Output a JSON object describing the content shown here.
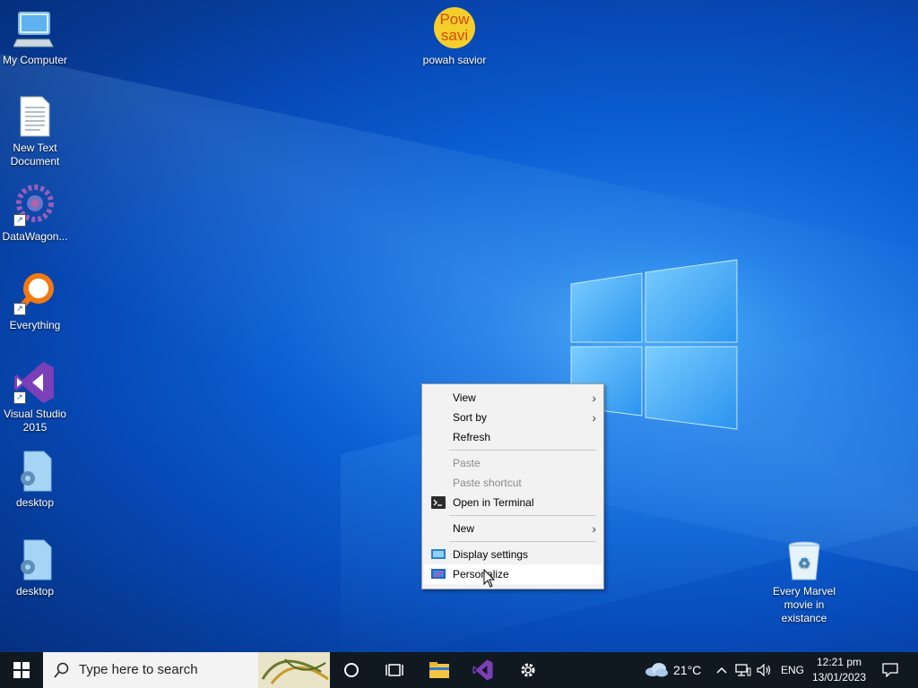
{
  "desktop": {
    "icons": [
      {
        "label": "My Computer"
      },
      {
        "label": "New Text Document"
      },
      {
        "label": "DataWagon..."
      },
      {
        "label": "Everything"
      },
      {
        "label": "Visual Studio 2015"
      },
      {
        "label": "desktop"
      },
      {
        "label": "desktop"
      },
      {
        "label": "powah savior"
      },
      {
        "label": "Every Marvel movie in existance"
      }
    ],
    "powah_badge_text": "Pow savi"
  },
  "context_menu": {
    "items": [
      {
        "label": "View",
        "has_submenu": true,
        "disabled": false
      },
      {
        "label": "Sort by",
        "has_submenu": true,
        "disabled": false
      },
      {
        "label": "Refresh",
        "has_submenu": false,
        "disabled": false
      },
      {
        "label": "Paste",
        "has_submenu": false,
        "disabled": true
      },
      {
        "label": "Paste shortcut",
        "has_submenu": false,
        "disabled": true
      },
      {
        "label": "Open in Terminal",
        "has_submenu": false,
        "disabled": false,
        "icon": "terminal-icon"
      },
      {
        "label": "New",
        "has_submenu": true,
        "disabled": false
      },
      {
        "label": "Display settings",
        "has_submenu": false,
        "disabled": false,
        "icon": "display-icon"
      },
      {
        "label": "Personalize",
        "has_submenu": false,
        "disabled": false,
        "icon": "personalize-icon",
        "hovered": true
      }
    ],
    "submenu_arrow": "›"
  },
  "taskbar": {
    "search_placeholder": "Type here to search",
    "weather": {
      "temp": "21°C",
      "icon": "cloud-icon"
    },
    "language": "ENG",
    "time": "12:21 pm",
    "date": "13/01/2023"
  },
  "colors": {
    "taskbar_bg": "#101820",
    "menu_bg": "#f2f2f2",
    "accent": "#0a5fd6"
  }
}
